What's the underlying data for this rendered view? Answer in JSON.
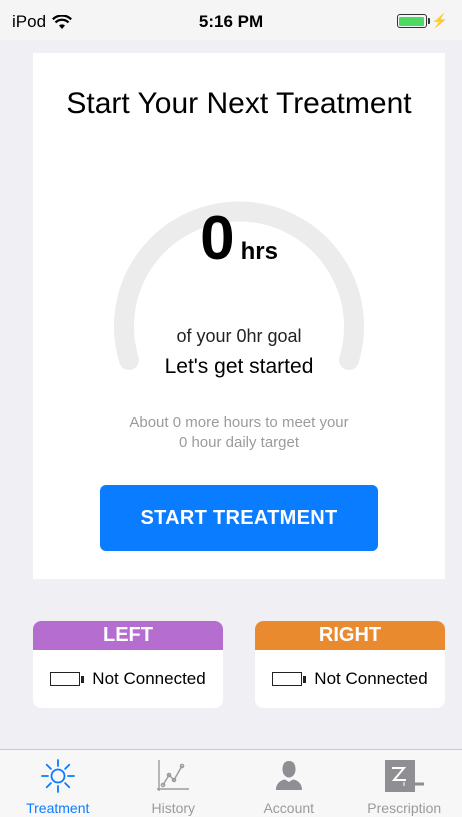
{
  "status_bar": {
    "carrier": "iPod",
    "time": "5:16 PM"
  },
  "card": {
    "title": "Start Your Next Treatment",
    "gauge_value": "0",
    "gauge_unit": "hrs",
    "gauge_goal": "of your 0hr goal",
    "progress_fraction": 0,
    "status": "Let's get started",
    "hint_line1": "About 0 more hours to meet your",
    "hint_line2": "0 hour daily target",
    "button_label": "START TREATMENT"
  },
  "devices": {
    "left": {
      "label": "LEFT",
      "status": "Not Connected",
      "color": "#b56dd0"
    },
    "right": {
      "label": "RIGHT",
      "status": "Not Connected",
      "color": "#ea8a2f"
    }
  },
  "tabs": [
    {
      "label": "Treatment",
      "icon": "sun-icon",
      "active": true
    },
    {
      "label": "History",
      "icon": "chart-icon",
      "active": false
    },
    {
      "label": "Account",
      "icon": "person-icon",
      "active": false
    },
    {
      "label": "Prescription",
      "icon": "prescription-icon",
      "active": false
    }
  ],
  "colors": {
    "accent": "#0a7cff",
    "battery": "#4cd964"
  }
}
